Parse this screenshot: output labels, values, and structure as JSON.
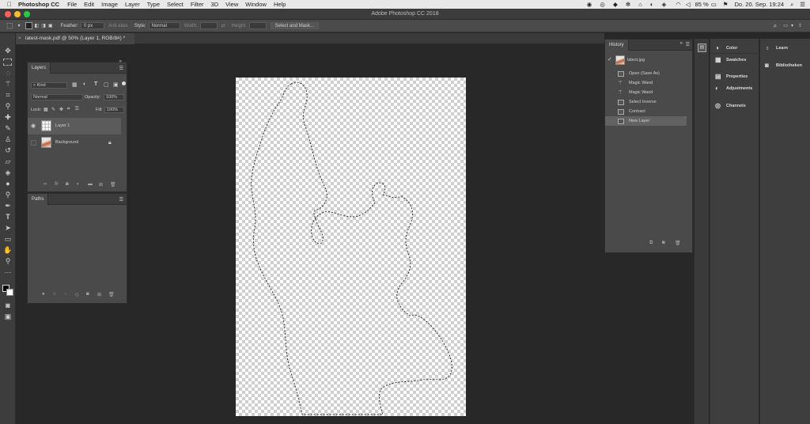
{
  "menubar": {
    "app": "Photoshop CC",
    "items": [
      "File",
      "Edit",
      "Image",
      "Layer",
      "Type",
      "Select",
      "Filter",
      "3D",
      "View",
      "Window",
      "Help"
    ],
    "battery": "85 %",
    "datetime": "Do. 20. Sep.  19:24"
  },
  "titlebar": {
    "title": "Adobe Photoshop CC 2018"
  },
  "options": {
    "feather_label": "Feather:",
    "feather_value": "0 px",
    "antialias": "Anti-alias",
    "style_label": "Style:",
    "style_value": "Normal",
    "width_label": "Width:",
    "height_label": "Height:",
    "select_mask": "Select and Mask..."
  },
  "document": {
    "tab": "latest-mask.pdf @ 50% (Layer 1, RGB/8#) *"
  },
  "layers": {
    "tab": "Layers",
    "filter": "Kind",
    "blend": "Normal",
    "opacity_label": "Opacity:",
    "opacity": "100%",
    "lock_label": "Lock:",
    "fill_label": "Fill:",
    "fill": "100%",
    "items": [
      {
        "name": "Layer 1"
      },
      {
        "name": "Background"
      }
    ]
  },
  "paths": {
    "tab": "Paths"
  },
  "history": {
    "tab": "History",
    "snapshot": "latest.jpg",
    "items": [
      "Open (Save As)",
      "Magic Wand",
      "Magic Wand",
      "Select Inverse",
      "Contract",
      "New Layer"
    ]
  },
  "right_panels": {
    "color": "Color",
    "swatches": "Swatches",
    "properties": "Properties",
    "adjustments": "Adjustments",
    "channels": "Channels",
    "learn": "Learn",
    "libraries": "Bibliotheken"
  },
  "colors": {
    "accent": "#4a4a4a",
    "selection": "#5a5a5a"
  }
}
